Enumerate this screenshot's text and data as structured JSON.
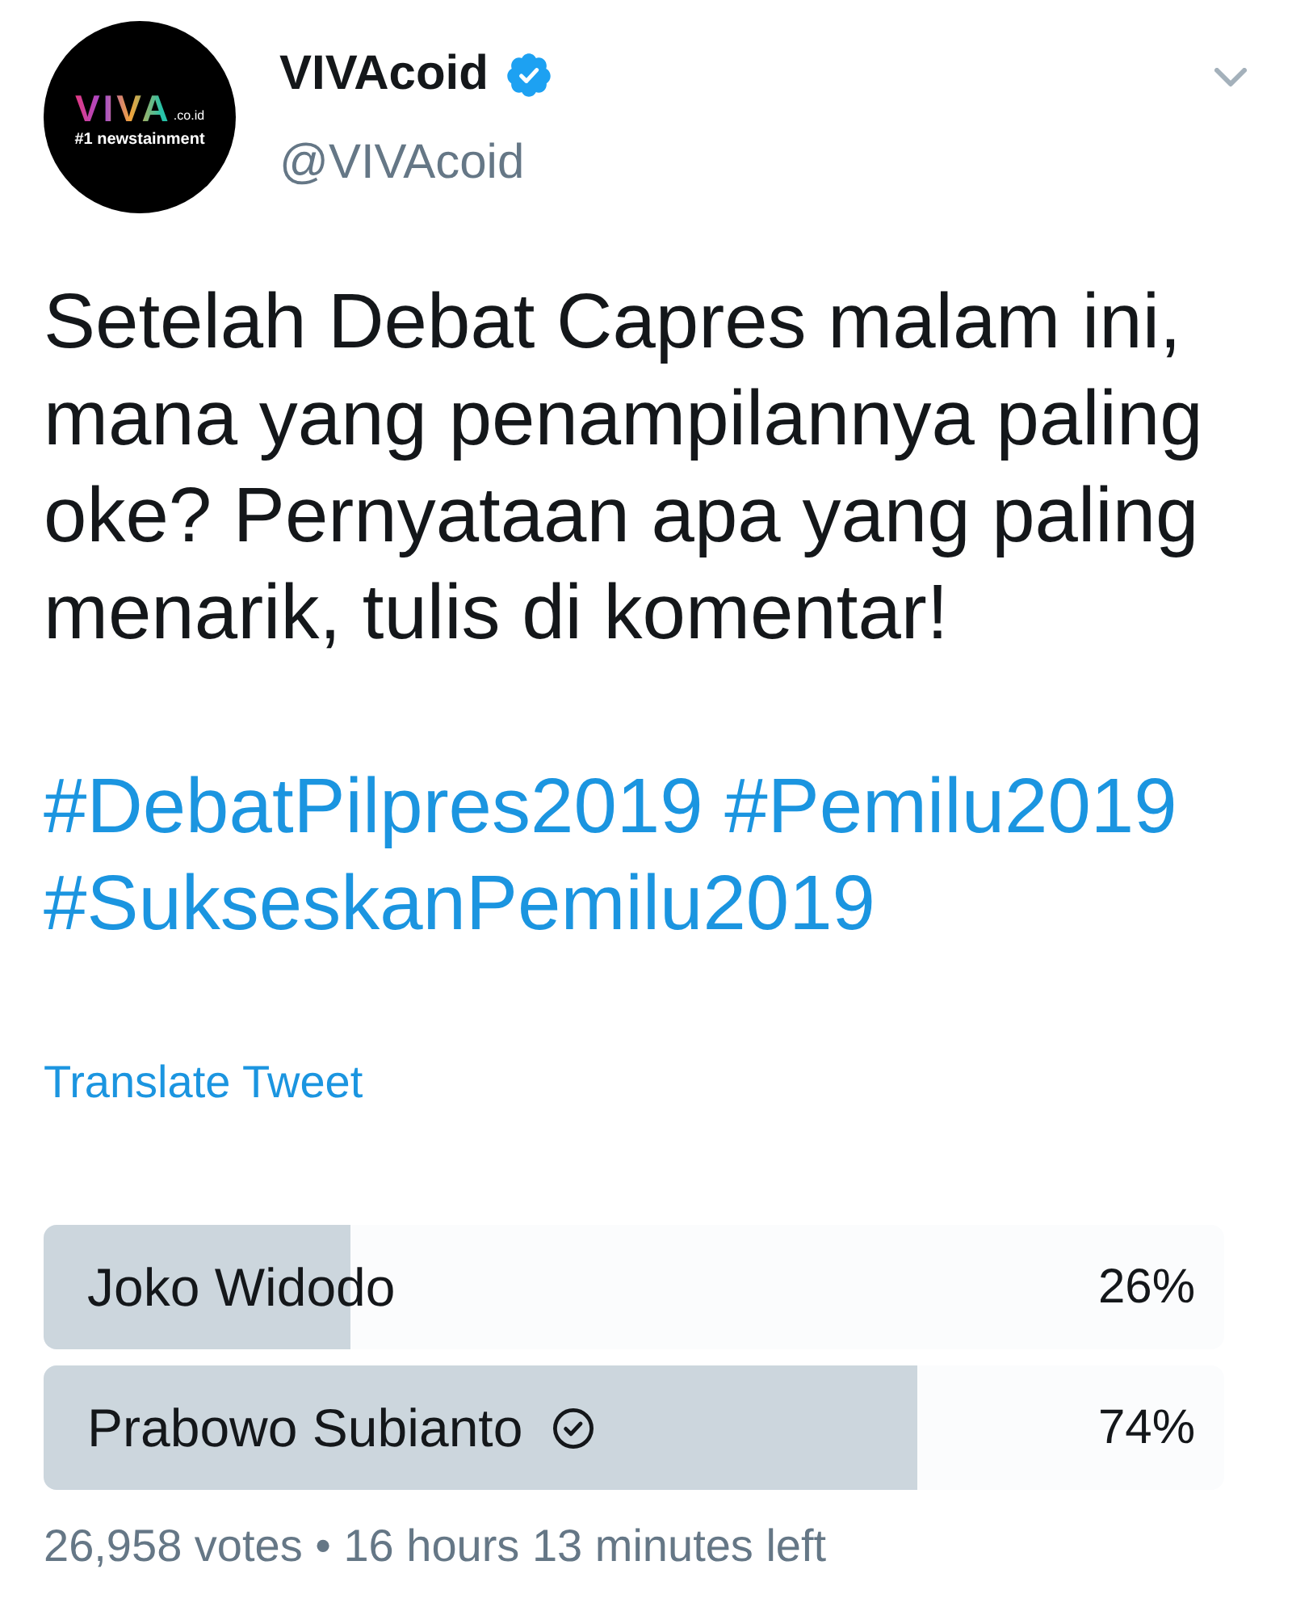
{
  "account": {
    "avatar": {
      "logo": "VIVA",
      "logo_suffix": ".co.id",
      "tagline": "#1 newstainment"
    },
    "name": "VIVAcoid",
    "verified": true,
    "handle": "@VIVAcoid"
  },
  "tweet": {
    "text": "Setelah Debat Capres malam ini, mana yang penampilannya paling oke? Pernyataan apa yang paling menarik, tulis di komentar!",
    "hashtags": [
      "#DebatPilpres2019",
      "#Pemilu2019",
      "#SukseskanPemilu2019"
    ],
    "translate_link": "Translate Tweet"
  },
  "poll": {
    "options": [
      {
        "label": "Joko Widodo",
        "percent": "26%",
        "level": 0.26,
        "selected": false
      },
      {
        "label": "Prabowo Subianto",
        "percent": "74%",
        "level": 0.74,
        "selected": true
      }
    ],
    "summary": "26,958 votes • 16 hours 13 minutes left"
  }
}
